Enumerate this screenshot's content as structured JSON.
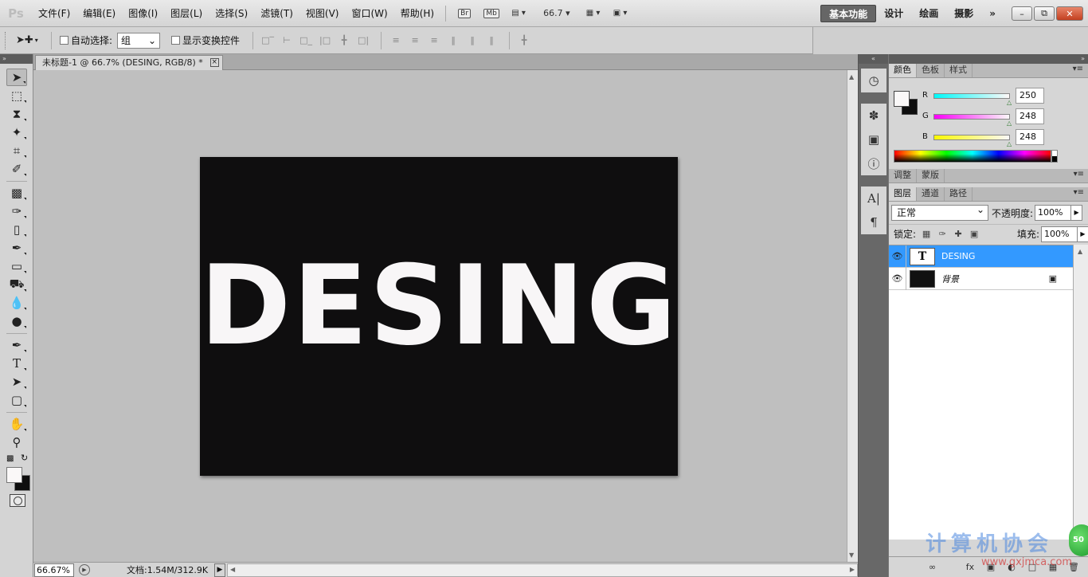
{
  "menubar": {
    "logo": "Ps",
    "menus": [
      "文件(F)",
      "编辑(E)",
      "图像(I)",
      "图层(L)",
      "选择(S)",
      "滤镜(T)",
      "视图(V)",
      "窗口(W)",
      "帮助(H)"
    ],
    "bridge": "Br",
    "minibridge": "Mb",
    "zoom": "66.7",
    "workspaces": [
      "基本功能",
      "设计",
      "绘画",
      "摄影"
    ],
    "more": "»"
  },
  "optbar": {
    "auto_select_label": "自动选择:",
    "auto_select_value": "组",
    "show_transform_label": "显示变换控件"
  },
  "document": {
    "tab_title": "未标题-1 @ 66.7% (DESING, RGB/8) *",
    "canvas_text": "DESING",
    "canvas_bg": "#0f0e0f",
    "text_color": "#f8f6f7",
    "zoom_field": "66.67%",
    "doc_info": "文档:1.54M/312.9K"
  },
  "color_panel": {
    "tabs": [
      "颜色",
      "色板",
      "样式"
    ],
    "r_label": "R",
    "g_label": "G",
    "b_label": "B",
    "r": "250",
    "g": "248",
    "b": "248",
    "foreground": "#faf8f8",
    "background": "#0e0e0e"
  },
  "adjust_panel": {
    "tabs": [
      "调整",
      "蒙版"
    ]
  },
  "layers_panel": {
    "tabs": [
      "图层",
      "通道",
      "路径"
    ],
    "blend_mode": "正常",
    "opacity_label": "不透明度:",
    "opacity": "100%",
    "lock_label": "锁定:",
    "fill_label": "填充:",
    "fill": "100%",
    "layers": [
      {
        "name": "DESING",
        "type": "text",
        "selected": true
      },
      {
        "name": "背景",
        "type": "background",
        "locked": true
      }
    ]
  },
  "badge_value": "50",
  "watermark": {
    "text": "计算机协会",
    "sub": "www.gxjmca.com"
  },
  "accent_color": "#3399ff"
}
